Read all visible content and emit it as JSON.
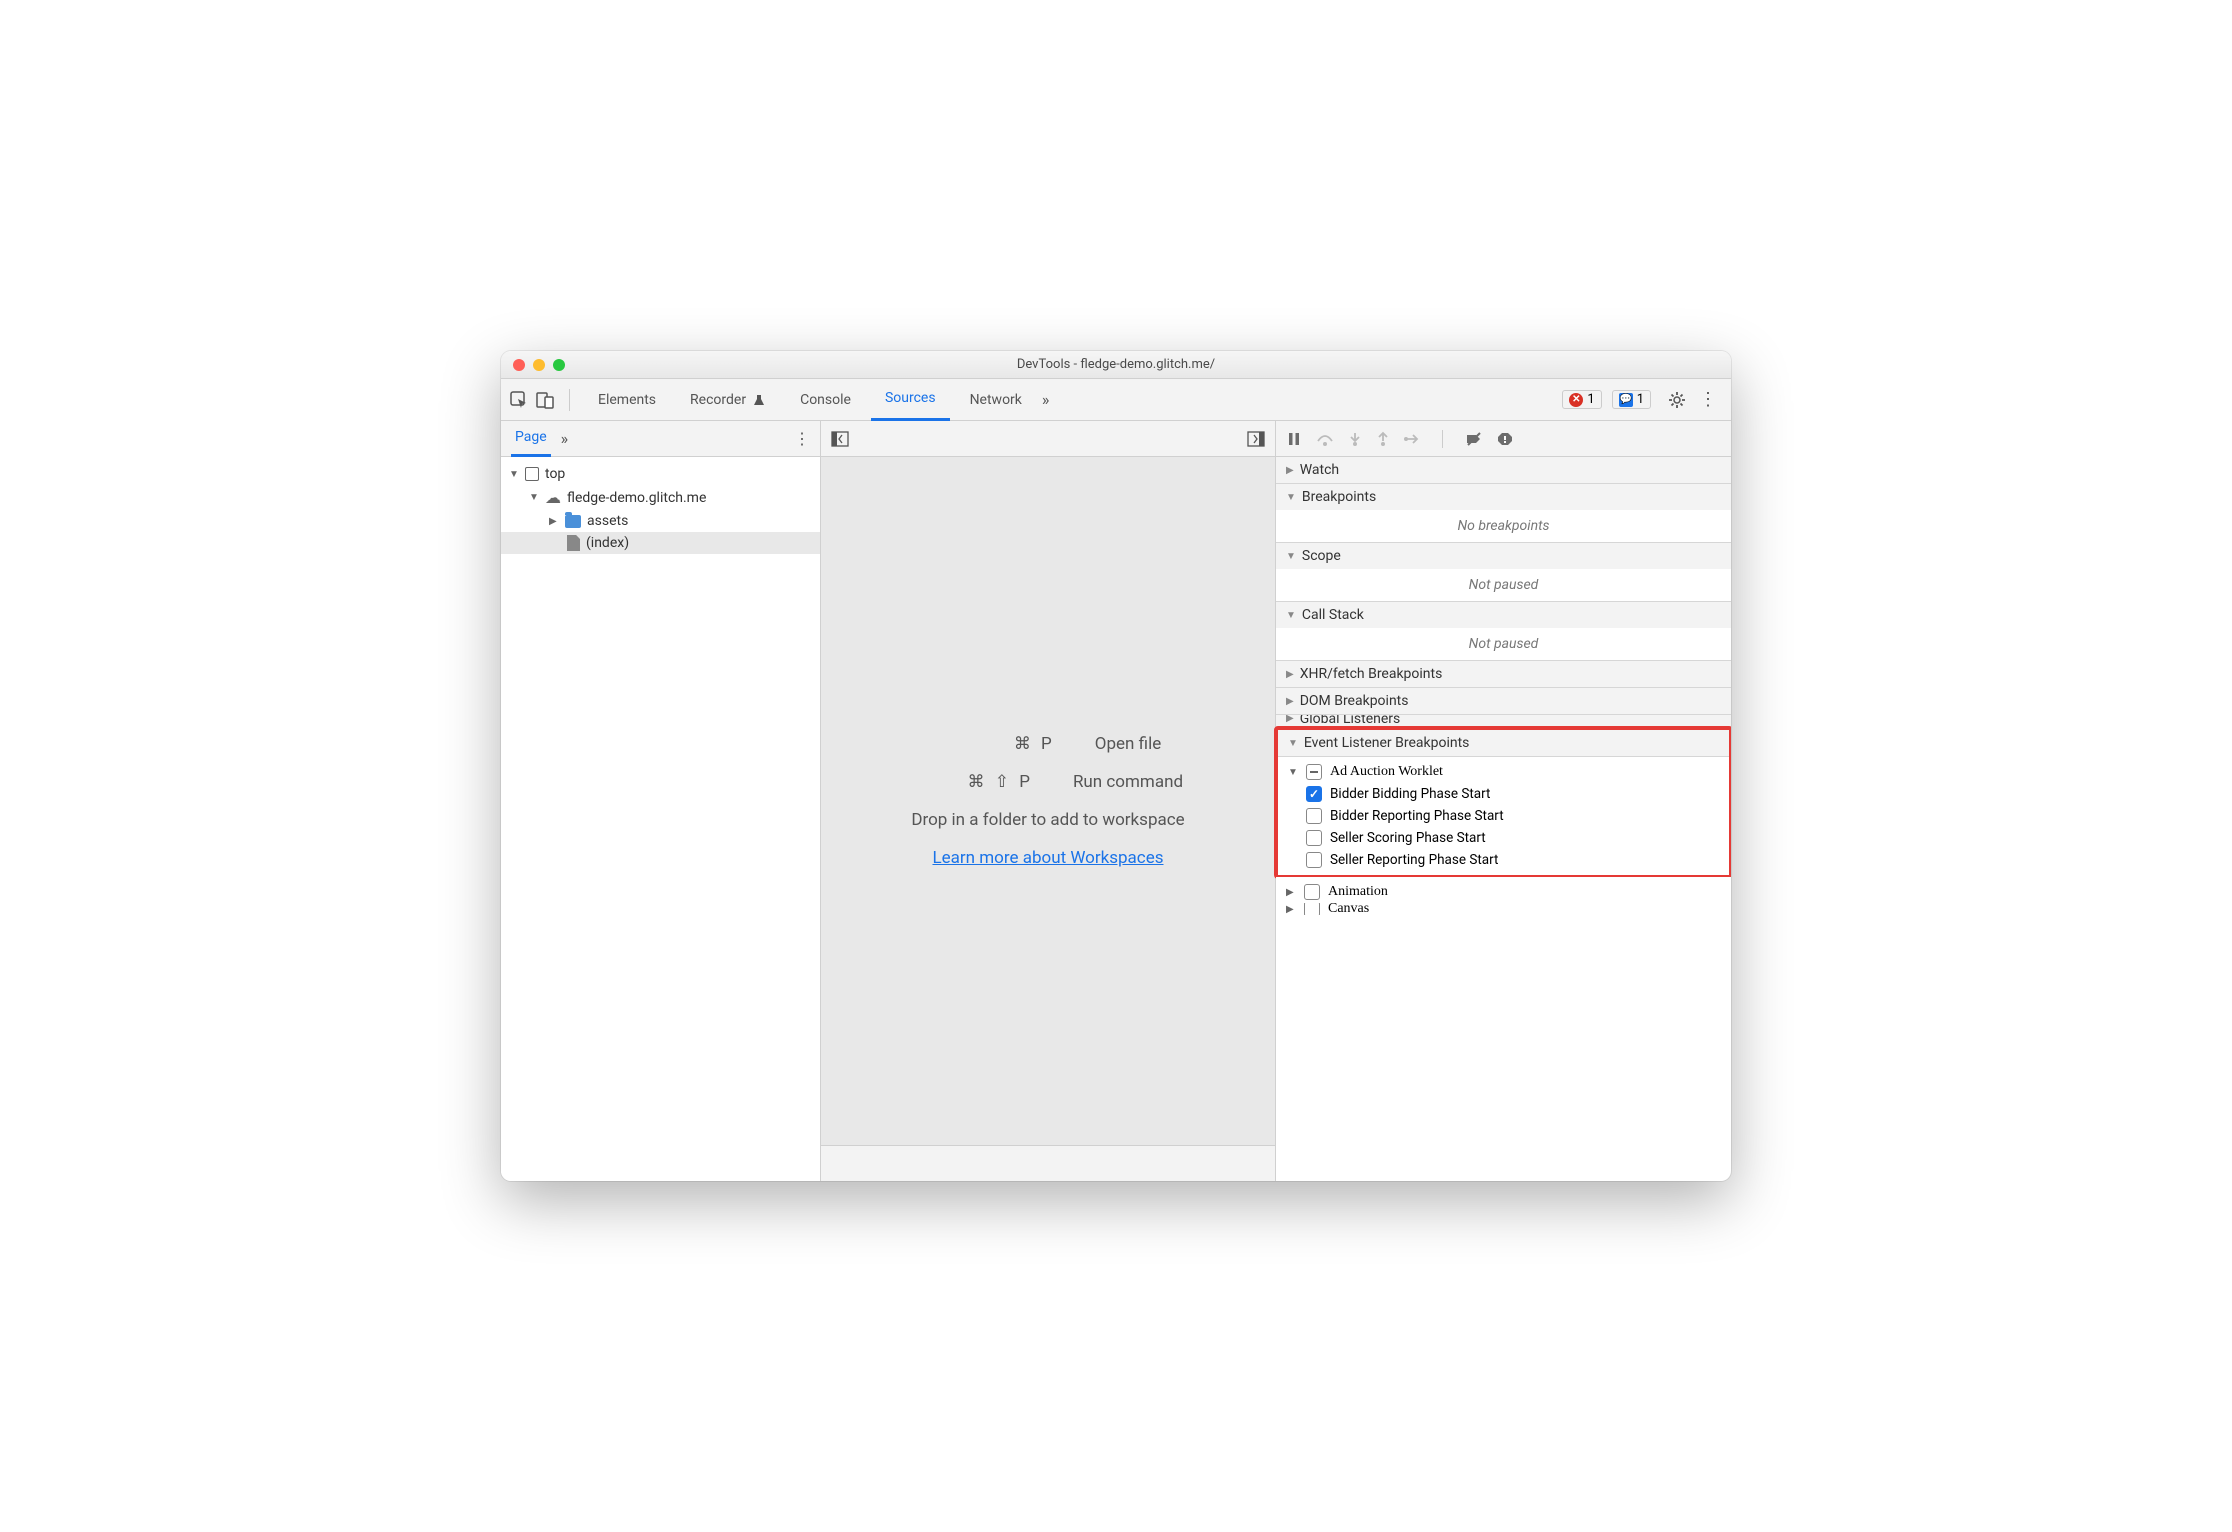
{
  "window": {
    "title": "DevTools - fledge-demo.glitch.me/"
  },
  "tabs": {
    "elements": "Elements",
    "recorder": "Recorder",
    "console": "Console",
    "sources": "Sources",
    "network": "Network"
  },
  "badges": {
    "errors": "1",
    "messages": "1"
  },
  "nav": {
    "page_tab": "Page",
    "top": "top",
    "domain": "fledge-demo.glitch.me",
    "folder": "assets",
    "file": "(index)"
  },
  "editor": {
    "open_key": "⌘ P",
    "open_label": "Open file",
    "run_key": "⌘ ⇧ P",
    "run_label": "Run command",
    "drop_hint": "Drop in a folder to add to workspace",
    "learn_link": "Learn more about Workspaces"
  },
  "debug": {
    "watch": "Watch",
    "breakpoints": "Breakpoints",
    "no_bp": "No breakpoints",
    "scope": "Scope",
    "not_paused1": "Not paused",
    "callstack": "Call Stack",
    "not_paused2": "Not paused",
    "xhr": "XHR/fetch Breakpoints",
    "dom": "DOM Breakpoints",
    "global": "Global Listeners",
    "elb": "Event Listener Breakpoints",
    "adworklet": "Ad Auction Worklet",
    "bp1": "Bidder Bidding Phase Start",
    "bp2": "Bidder Reporting Phase Start",
    "bp3": "Seller Scoring Phase Start",
    "bp4": "Seller Reporting Phase Start",
    "animation": "Animation",
    "canvas": "Canvas"
  }
}
